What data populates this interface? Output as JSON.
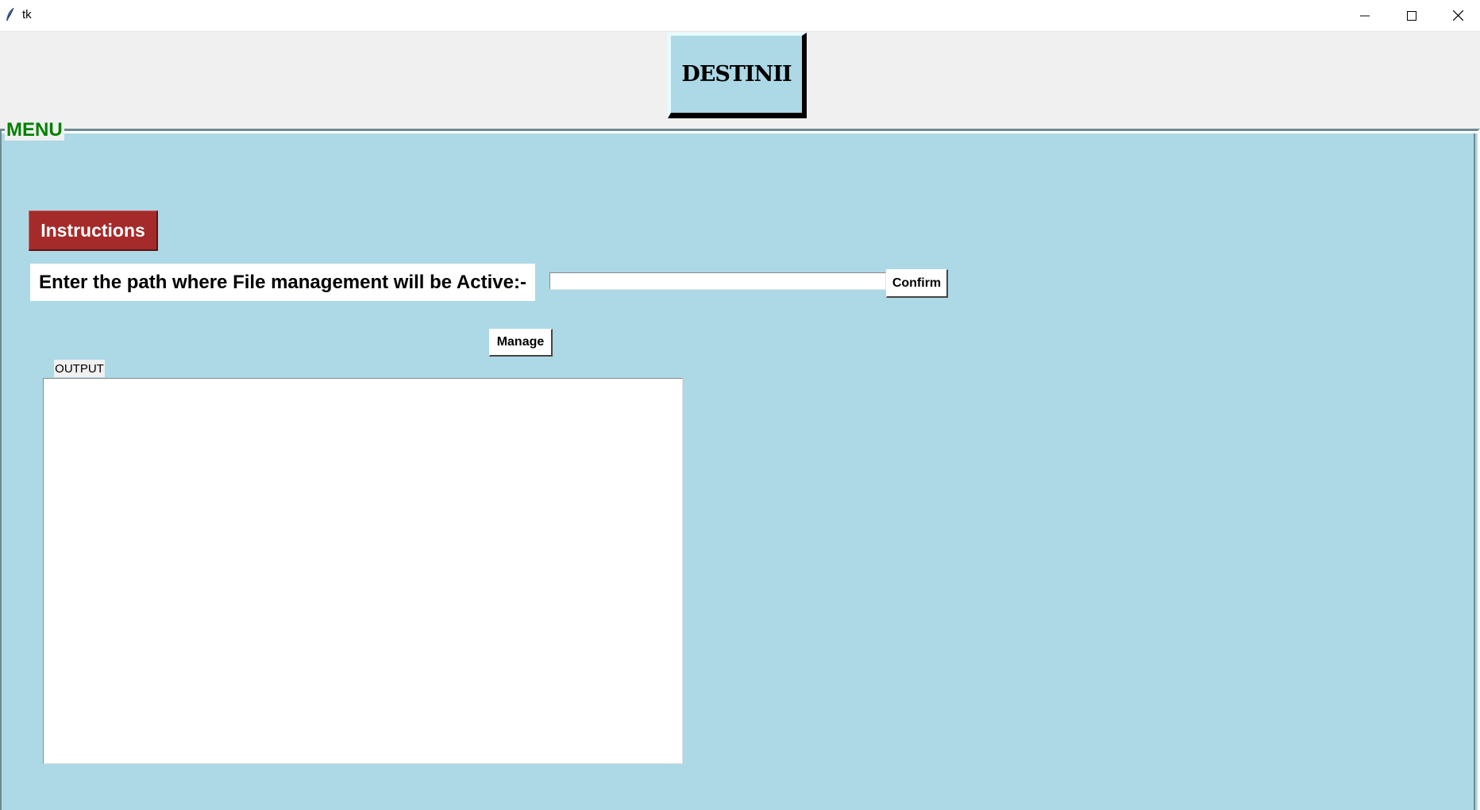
{
  "window": {
    "title": "tk",
    "icon": "tk-feather-icon",
    "controls": [
      "minimize-icon",
      "maximize-icon",
      "close-icon"
    ]
  },
  "header": {
    "logo_button": "DESTINII"
  },
  "menu": {
    "label": "MENU",
    "instructions_button": "Instructions",
    "path_prompt": "Enter the path where File management will be Active:-",
    "path_input_value": "",
    "confirm_button": "Confirm",
    "manage_button": "Manage",
    "output_label": "OUTPUT",
    "output_text": ""
  },
  "colors": {
    "menu_background": "#add8e6",
    "menu_label": "#008000",
    "instructions_background": "#a52a2a",
    "logo_background": "#add8e6"
  }
}
